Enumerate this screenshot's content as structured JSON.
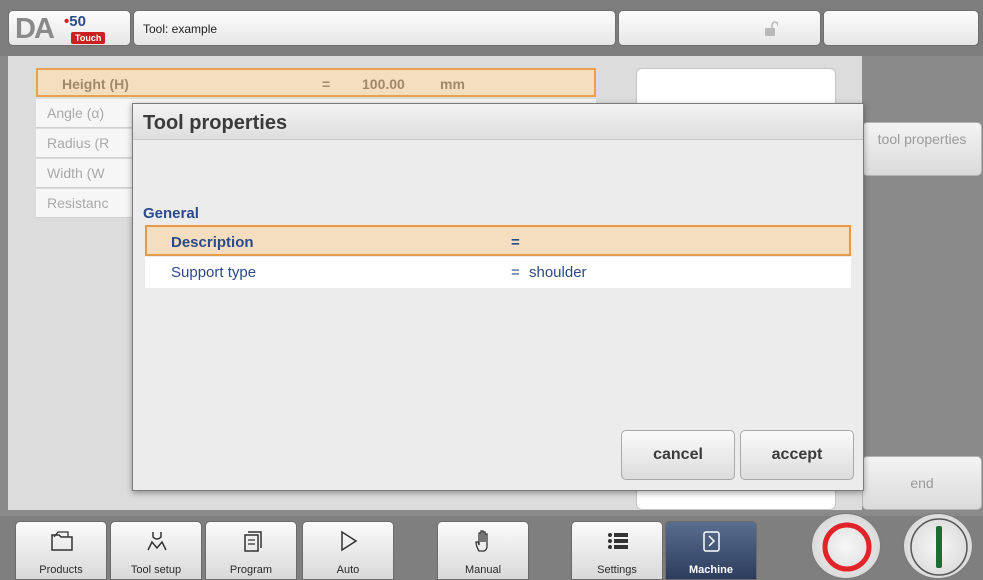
{
  "header": {
    "logo_da": "DA",
    "logo_dot": "•",
    "logo_model": "50",
    "logo_touch": "Touch",
    "title": "Tool: example"
  },
  "background_rows": [
    {
      "label": "Height (H)",
      "eq": "=",
      "value": "100.00",
      "unit": "mm"
    },
    {
      "label": "Angle (α)"
    },
    {
      "label": "Radius (R"
    },
    {
      "label": "Width (W"
    },
    {
      "label": "Resistanc"
    }
  ],
  "side_buttons": {
    "tool_properties": "tool properties",
    "end": "end"
  },
  "dialog": {
    "title": "Tool properties",
    "section": "General",
    "rows": [
      {
        "label": "Description",
        "eq": "=",
        "value": ""
      },
      {
        "label": "Support type",
        "eq": "=",
        "value": "shoulder"
      }
    ],
    "cancel": "cancel",
    "accept": "accept"
  },
  "nav": [
    {
      "label": "Products",
      "icon": "folder-icon"
    },
    {
      "label": "Tool setup",
      "icon": "tool-setup-icon"
    },
    {
      "label": "Program",
      "icon": "program-icon"
    },
    {
      "label": "Auto",
      "icon": "play-icon"
    },
    {
      "label": "Manual",
      "icon": "hand-icon"
    },
    {
      "label": "Settings",
      "icon": "settings-list-icon"
    },
    {
      "label": "Machine",
      "icon": "machine-icon",
      "active": true
    }
  ],
  "colors": {
    "accent_orange": "#e59b45",
    "highlight_bg": "#f5ddc0",
    "text_blue": "#2b4a8a",
    "stop_red": "#e2232a",
    "start_green": "#1f6b33"
  }
}
